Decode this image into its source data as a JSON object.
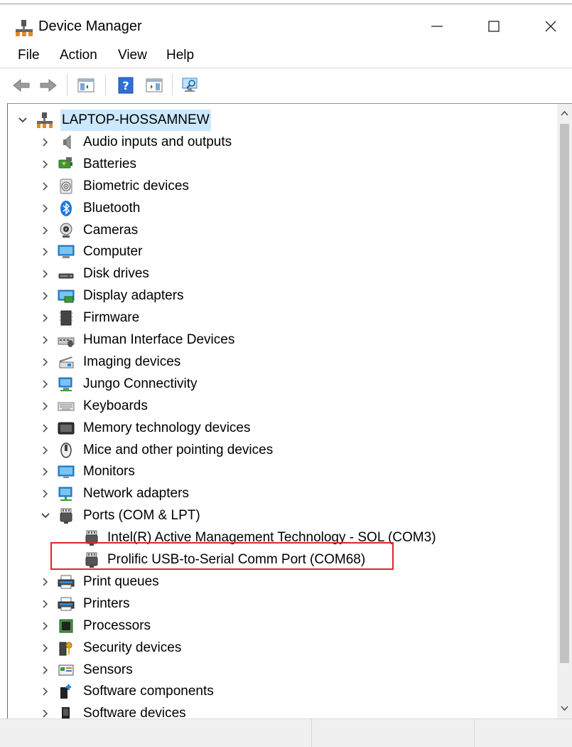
{
  "window": {
    "title": "Device Manager"
  },
  "menu": [
    "File",
    "Action",
    "View",
    "Help"
  ],
  "toolbar": {
    "icons": [
      "back-arrow-icon",
      "forward-arrow-icon",
      "show-hide-console-tree-icon",
      "help-icon",
      "properties-pane-icon",
      "scan-hardware-changes-icon"
    ]
  },
  "tree": {
    "root": {
      "label": "LAPTOP-HOSSAMNEW",
      "expanded": true,
      "selected": true
    },
    "categories": [
      {
        "label": "Audio inputs and outputs",
        "icon": "speaker-icon"
      },
      {
        "label": "Batteries",
        "icon": "battery-icon"
      },
      {
        "label": "Biometric devices",
        "icon": "fingerprint-icon"
      },
      {
        "label": "Bluetooth",
        "icon": "bluetooth-icon"
      },
      {
        "label": "Cameras",
        "icon": "camera-icon"
      },
      {
        "label": "Computer",
        "icon": "computer-icon"
      },
      {
        "label": "Disk drives",
        "icon": "disk-drive-icon"
      },
      {
        "label": "Display adapters",
        "icon": "display-adapter-icon"
      },
      {
        "label": "Firmware",
        "icon": "firmware-chip-icon"
      },
      {
        "label": "Human Interface Devices",
        "icon": "hid-icon"
      },
      {
        "label": "Imaging devices",
        "icon": "scanner-icon"
      },
      {
        "label": "Jungo Connectivity",
        "icon": "network-monitor-icon"
      },
      {
        "label": "Keyboards",
        "icon": "keyboard-icon"
      },
      {
        "label": "Memory technology devices",
        "icon": "memory-card-icon"
      },
      {
        "label": "Mice and other pointing devices",
        "icon": "mouse-icon"
      },
      {
        "label": "Monitors",
        "icon": "monitor-icon"
      },
      {
        "label": "Network adapters",
        "icon": "network-adapter-icon"
      },
      {
        "label": "Ports (COM & LPT)",
        "icon": "port-connector-icon",
        "expanded": true,
        "children": [
          {
            "label": "Intel(R) Active Management Technology - SOL (COM3)",
            "icon": "port-connector-icon"
          },
          {
            "label": "Prolific USB-to-Serial Comm Port (COM68)",
            "icon": "port-connector-icon",
            "highlighted": true
          }
        ]
      },
      {
        "label": "Print queues",
        "icon": "printer-icon"
      },
      {
        "label": "Printers",
        "icon": "printer-icon"
      },
      {
        "label": "Processors",
        "icon": "processor-icon"
      },
      {
        "label": "Security devices",
        "icon": "security-key-icon"
      },
      {
        "label": "Sensors",
        "icon": "sensor-icon"
      },
      {
        "label": "Software components",
        "icon": "software-component-icon"
      },
      {
        "label": "Software devices",
        "icon": "software-device-icon"
      }
    ]
  },
  "colors": {
    "selection": "#cce8ff",
    "highlight_border": "#e0242b",
    "window_bg": "#ffffff"
  }
}
